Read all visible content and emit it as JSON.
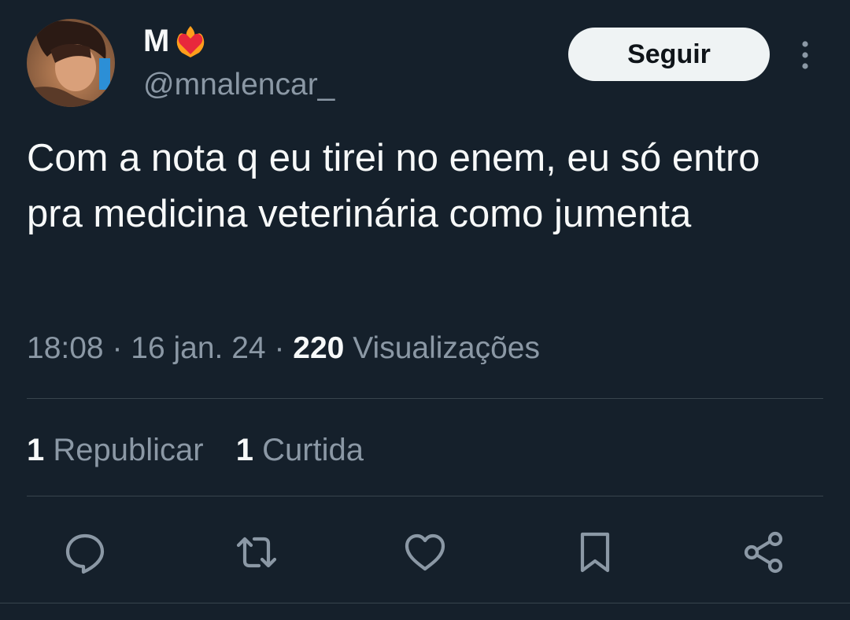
{
  "user": {
    "name": "M",
    "handle": "@mnalencar_",
    "avatar_icon": "user-avatar-photo",
    "badge_icon": "heart-on-fire-emoji"
  },
  "follow_button": {
    "label": "Seguir"
  },
  "tweet": {
    "text": "Com a nota q eu tirei no enem, eu só entro pra medicina veterinária como jumenta"
  },
  "meta": {
    "time": "18:08",
    "sep1": "·",
    "date": "16 jan. 24",
    "sep2": "·",
    "views_count": "220",
    "views_label": "Visualizações"
  },
  "stats": {
    "reposts_count": "1",
    "reposts_label": "Republicar",
    "likes_count": "1",
    "likes_label": "Curtida"
  },
  "actions": [
    "reply-icon",
    "repost-icon",
    "like-icon",
    "bookmark-icon",
    "share-icon"
  ],
  "colors": {
    "background": "#15202b",
    "text": "#f7f9f9",
    "secondary": "#8b98a5",
    "divider": "#38444d",
    "button_bg": "#eff3f4"
  }
}
